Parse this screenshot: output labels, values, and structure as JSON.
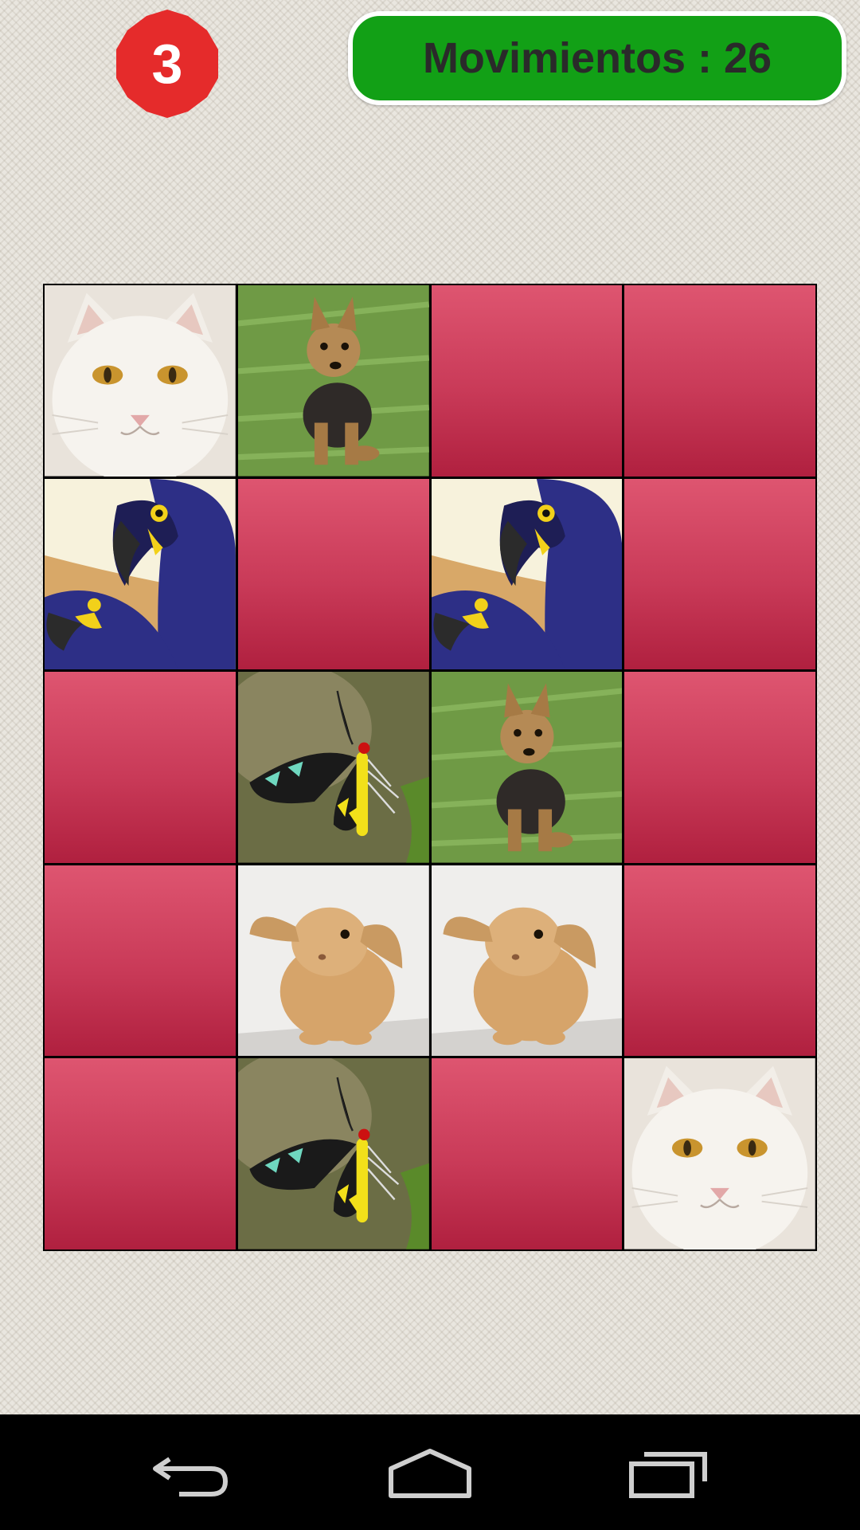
{
  "header": {
    "level": "3",
    "moves_label": "Movimientos",
    "moves_separator": " : ",
    "moves_count": "26"
  },
  "colors": {
    "badge": "#e52b2b",
    "moves_bg": "#12a016",
    "card_back_top": "#de5570",
    "card_back_bottom": "#b0203f",
    "navbar": "#000000"
  },
  "board": {
    "rows": 5,
    "cols": 4,
    "tiles": [
      "cat",
      "dog",
      "hidden",
      "hidden",
      "parrot",
      "hidden",
      "parrot",
      "hidden",
      "hidden",
      "butterfly",
      "dog",
      "hidden",
      "hidden",
      "rabbit",
      "rabbit",
      "hidden",
      "hidden",
      "butterfly",
      "hidden",
      "cat"
    ]
  },
  "navbar": {
    "buttons": [
      "back-icon",
      "home-icon",
      "recents-icon"
    ]
  }
}
